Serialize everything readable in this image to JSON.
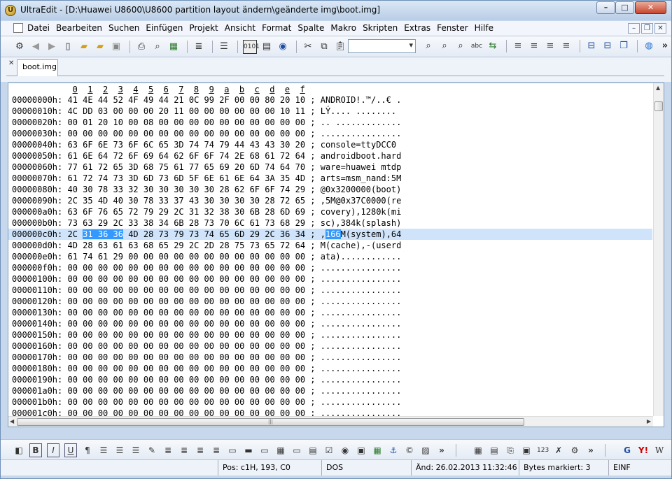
{
  "window": {
    "title": "UltraEdit - [D:\\Huawei U8600\\U8600 partition layout ändern\\geänderte img\\boot.img]"
  },
  "menu": {
    "items": [
      "Datei",
      "Bearbeiten",
      "Suchen",
      "Einfügen",
      "Projekt",
      "Ansicht",
      "Format",
      "Spalte",
      "Makro",
      "Skripten",
      "Extras",
      "Fenster",
      "Hilfe"
    ]
  },
  "tab": {
    "label": "boot.img"
  },
  "hex": {
    "ruler": [
      "0",
      "1",
      "2",
      "3",
      "4",
      "5",
      "6",
      "7",
      "8",
      "9",
      "a",
      "b",
      "c",
      "d",
      "e",
      "f"
    ],
    "rows": [
      {
        "addr": "00000000h:",
        "bytes": "41 4E 44 52 4F 49 44 21 0C 99 2F 00 00 80 20 10",
        "text": "ANDROID!.™/..€ ."
      },
      {
        "addr": "00000010h:",
        "bytes": "4C DD 03 00 00 00 20 11 00 00 00 00 00 00 10 11",
        "text": "LÝ.... ........"
      },
      {
        "addr": "00000020h:",
        "bytes": "00 01 20 10 00 08 00 00 00 00 00 00 00 00 00 00",
        "text": ".. ............."
      },
      {
        "addr": "00000030h:",
        "bytes": "00 00 00 00 00 00 00 00 00 00 00 00 00 00 00 00",
        "text": "................"
      },
      {
        "addr": "00000040h:",
        "bytes": "63 6F 6E 73 6F 6C 65 3D 74 74 79 44 43 43 30 20",
        "text": "console=ttyDCC0"
      },
      {
        "addr": "00000050h:",
        "bytes": "61 6E 64 72 6F 69 64 62 6F 6F 74 2E 68 61 72 64",
        "text": "androidboot.hard"
      },
      {
        "addr": "00000060h:",
        "bytes": "77 61 72 65 3D 68 75 61 77 65 69 20 6D 74 64 70",
        "text": "ware=huawei mtdp"
      },
      {
        "addr": "00000070h:",
        "bytes": "61 72 74 73 3D 6D 73 6D 5F 6E 61 6E 64 3A 35 4D",
        "text": "arts=msm_nand:5M"
      },
      {
        "addr": "00000080h:",
        "bytes": "40 30 78 33 32 30 30 30 30 30 28 62 6F 6F 74 29",
        "text": "@0x3200000(boot)"
      },
      {
        "addr": "00000090h:",
        "bytes": "2C 35 4D 40 30 78 33 37 43 30 30 30 30 28 72 65",
        "text": ",5M@0x37C0000(re"
      },
      {
        "addr": "000000a0h:",
        "bytes": "63 6F 76 65 72 79 29 2C 31 32 38 30 6B 28 6D 69",
        "text": "covery),1280k(mi"
      },
      {
        "addr": "000000b0h:",
        "bytes": "73 63 29 2C 33 38 34 6B 28 73 70 6C 61 73 68 29",
        "text": "sc),384k(splash)"
      },
      {
        "addr": "000000c0h:",
        "bytes_pre": "2C ",
        "bytes_hl": "31 36 36",
        "bytes_post": " 4D 28 73 79 73 74 65 6D 29 2C 36 34",
        "text_pre": ",",
        "text_hl": "166",
        "text_post": "M(system),64",
        "selected": true
      },
      {
        "addr": "000000d0h:",
        "bytes": "4D 28 63 61 63 68 65 29 2C 2D 28 75 73 65 72 64",
        "text": "M(cache),-(userd"
      },
      {
        "addr": "000000e0h:",
        "bytes": "61 74 61 29 00 00 00 00 00 00 00 00 00 00 00 00",
        "text": "ata)............"
      },
      {
        "addr": "000000f0h:",
        "bytes": "00 00 00 00 00 00 00 00 00 00 00 00 00 00 00 00",
        "text": "................"
      },
      {
        "addr": "00000100h:",
        "bytes": "00 00 00 00 00 00 00 00 00 00 00 00 00 00 00 00",
        "text": "................"
      },
      {
        "addr": "00000110h:",
        "bytes": "00 00 00 00 00 00 00 00 00 00 00 00 00 00 00 00",
        "text": "................"
      },
      {
        "addr": "00000120h:",
        "bytes": "00 00 00 00 00 00 00 00 00 00 00 00 00 00 00 00",
        "text": "................"
      },
      {
        "addr": "00000130h:",
        "bytes": "00 00 00 00 00 00 00 00 00 00 00 00 00 00 00 00",
        "text": "................"
      },
      {
        "addr": "00000140h:",
        "bytes": "00 00 00 00 00 00 00 00 00 00 00 00 00 00 00 00",
        "text": "................"
      },
      {
        "addr": "00000150h:",
        "bytes": "00 00 00 00 00 00 00 00 00 00 00 00 00 00 00 00",
        "text": "................"
      },
      {
        "addr": "00000160h:",
        "bytes": "00 00 00 00 00 00 00 00 00 00 00 00 00 00 00 00",
        "text": "................"
      },
      {
        "addr": "00000170h:",
        "bytes": "00 00 00 00 00 00 00 00 00 00 00 00 00 00 00 00",
        "text": "................"
      },
      {
        "addr": "00000180h:",
        "bytes": "00 00 00 00 00 00 00 00 00 00 00 00 00 00 00 00",
        "text": "................"
      },
      {
        "addr": "00000190h:",
        "bytes": "00 00 00 00 00 00 00 00 00 00 00 00 00 00 00 00",
        "text": "................"
      },
      {
        "addr": "000001a0h:",
        "bytes": "00 00 00 00 00 00 00 00 00 00 00 00 00 00 00 00",
        "text": "................"
      },
      {
        "addr": "000001b0h:",
        "bytes": "00 00 00 00 00 00 00 00 00 00 00 00 00 00 00 00",
        "text": "................"
      },
      {
        "addr": "000001c0h:",
        "bytes": "00 00 00 00 00 00 00 00 00 00 00 00 00 00 00 00",
        "text": "................"
      }
    ]
  },
  "status": {
    "position": "Pos: c1H, 193, C0",
    "line_ending": "DOS",
    "modified": "Änd: 26.02.2013 11:32:46",
    "selected_bytes": "Bytes markiert: 3",
    "insert_mode": "EINF"
  },
  "colors": {
    "selection_row": "#cfe4fb",
    "selection_highlight": "#3399ff"
  }
}
